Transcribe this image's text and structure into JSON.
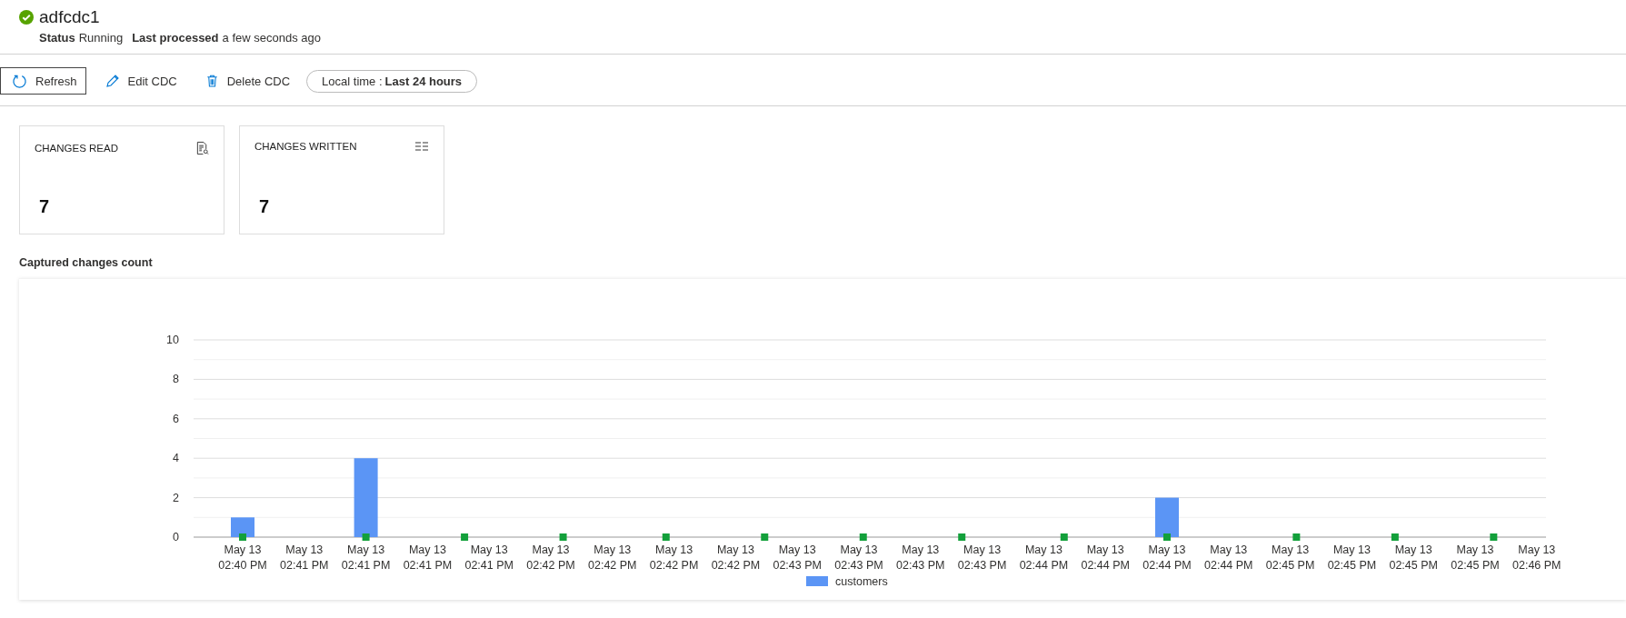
{
  "header": {
    "title": "adfcdc1",
    "status_ok": true,
    "status_label": "Status",
    "status_value": "Running",
    "processed_label": "Last processed",
    "processed_value": "a few seconds ago"
  },
  "toolbar": [
    {
      "kind": "refresh",
      "label": "Refresh",
      "selected": true
    },
    {
      "kind": "edit",
      "label": "Edit CDC",
      "selected": false
    },
    {
      "kind": "delete",
      "label": "Delete CDC",
      "selected": false
    }
  ],
  "time_filter": {
    "label": "Local time : ",
    "value": "Last 24 hours"
  },
  "cards": [
    {
      "kind": "read",
      "title": "CHANGES READ",
      "value": "7"
    },
    {
      "kind": "written",
      "title": "CHANGES WRITTEN",
      "value": "7"
    }
  ],
  "chart_section": {
    "title": "Captured changes count",
    "chart_data": {
      "type": "bar",
      "categories": [
        "May 13\n02:40 PM",
        "May 13\n02:41 PM",
        "May 13\n02:41 PM",
        "May 13\n02:41 PM",
        "May 13\n02:41 PM",
        "May 13\n02:42 PM",
        "May 13\n02:42 PM",
        "May 13\n02:42 PM",
        "May 13\n02:42 PM",
        "May 13\n02:43 PM",
        "May 13\n02:43 PM",
        "May 13\n02:43 PM",
        "May 13\n02:43 PM",
        "May 13\n02:44 PM",
        "May 13\n02:44 PM",
        "May 13\n02:44 PM",
        "May 13\n02:44 PM",
        "May 13\n02:45 PM",
        "May 13\n02:45 PM",
        "May 13\n02:45 PM",
        "May 13\n02:45 PM",
        "May 13\n02:46 PM"
      ],
      "series": [
        {
          "name": "customers",
          "color": "#5b95f5",
          "values": [
            1,
            null,
            4,
            null,
            null,
            null,
            null,
            null,
            null,
            null,
            null,
            null,
            null,
            null,
            null,
            2,
            null,
            null,
            null,
            null,
            null,
            null
          ]
        }
      ],
      "ylim": [
        0,
        10
      ],
      "yticks": [
        0,
        2,
        4,
        6,
        8,
        10
      ],
      "grid": true
    }
  }
}
